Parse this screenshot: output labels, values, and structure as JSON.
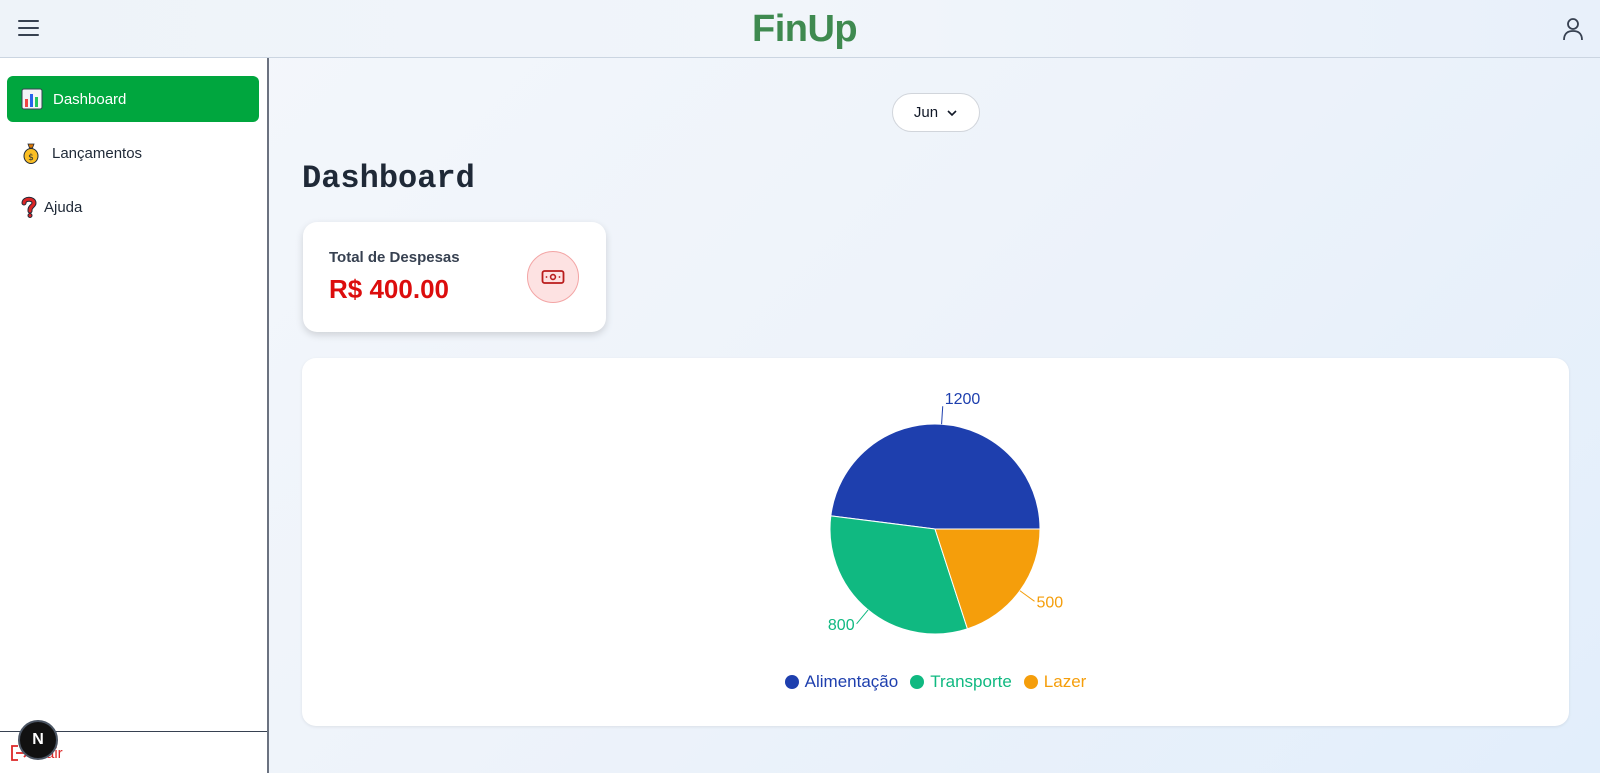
{
  "app": {
    "brand": "FinUp"
  },
  "sidebar": {
    "items": [
      {
        "label": "Dashboard",
        "icon": "bar-chart-icon",
        "active": true
      },
      {
        "label": "Lançamentos",
        "icon": "money-bag-icon",
        "active": false
      },
      {
        "label": "Ajuda",
        "icon": "question-mark-icon",
        "active": false
      }
    ],
    "logout_label": "Sair",
    "badge_letter": "N"
  },
  "filter": {
    "month": "Jun"
  },
  "main": {
    "title": "Dashboard",
    "expense_card": {
      "label": "Total de Despesas",
      "value": "R$ 400.00",
      "icon": "cash-icon"
    }
  },
  "colors": {
    "brand": "#3f8a50",
    "active": "#00a63e",
    "expense": "#dc0d0d",
    "alimentacao": "#1e3fae",
    "transporte": "#10b981",
    "lazer": "#f59e0b"
  },
  "chart_data": {
    "type": "pie",
    "categories": [
      "Alimentação",
      "Transporte",
      "Lazer"
    ],
    "values": [
      1200,
      800,
      500
    ],
    "colors": [
      "#1e3fae",
      "#10b981",
      "#f59e0b"
    ],
    "legend": "bottom",
    "title": ""
  }
}
